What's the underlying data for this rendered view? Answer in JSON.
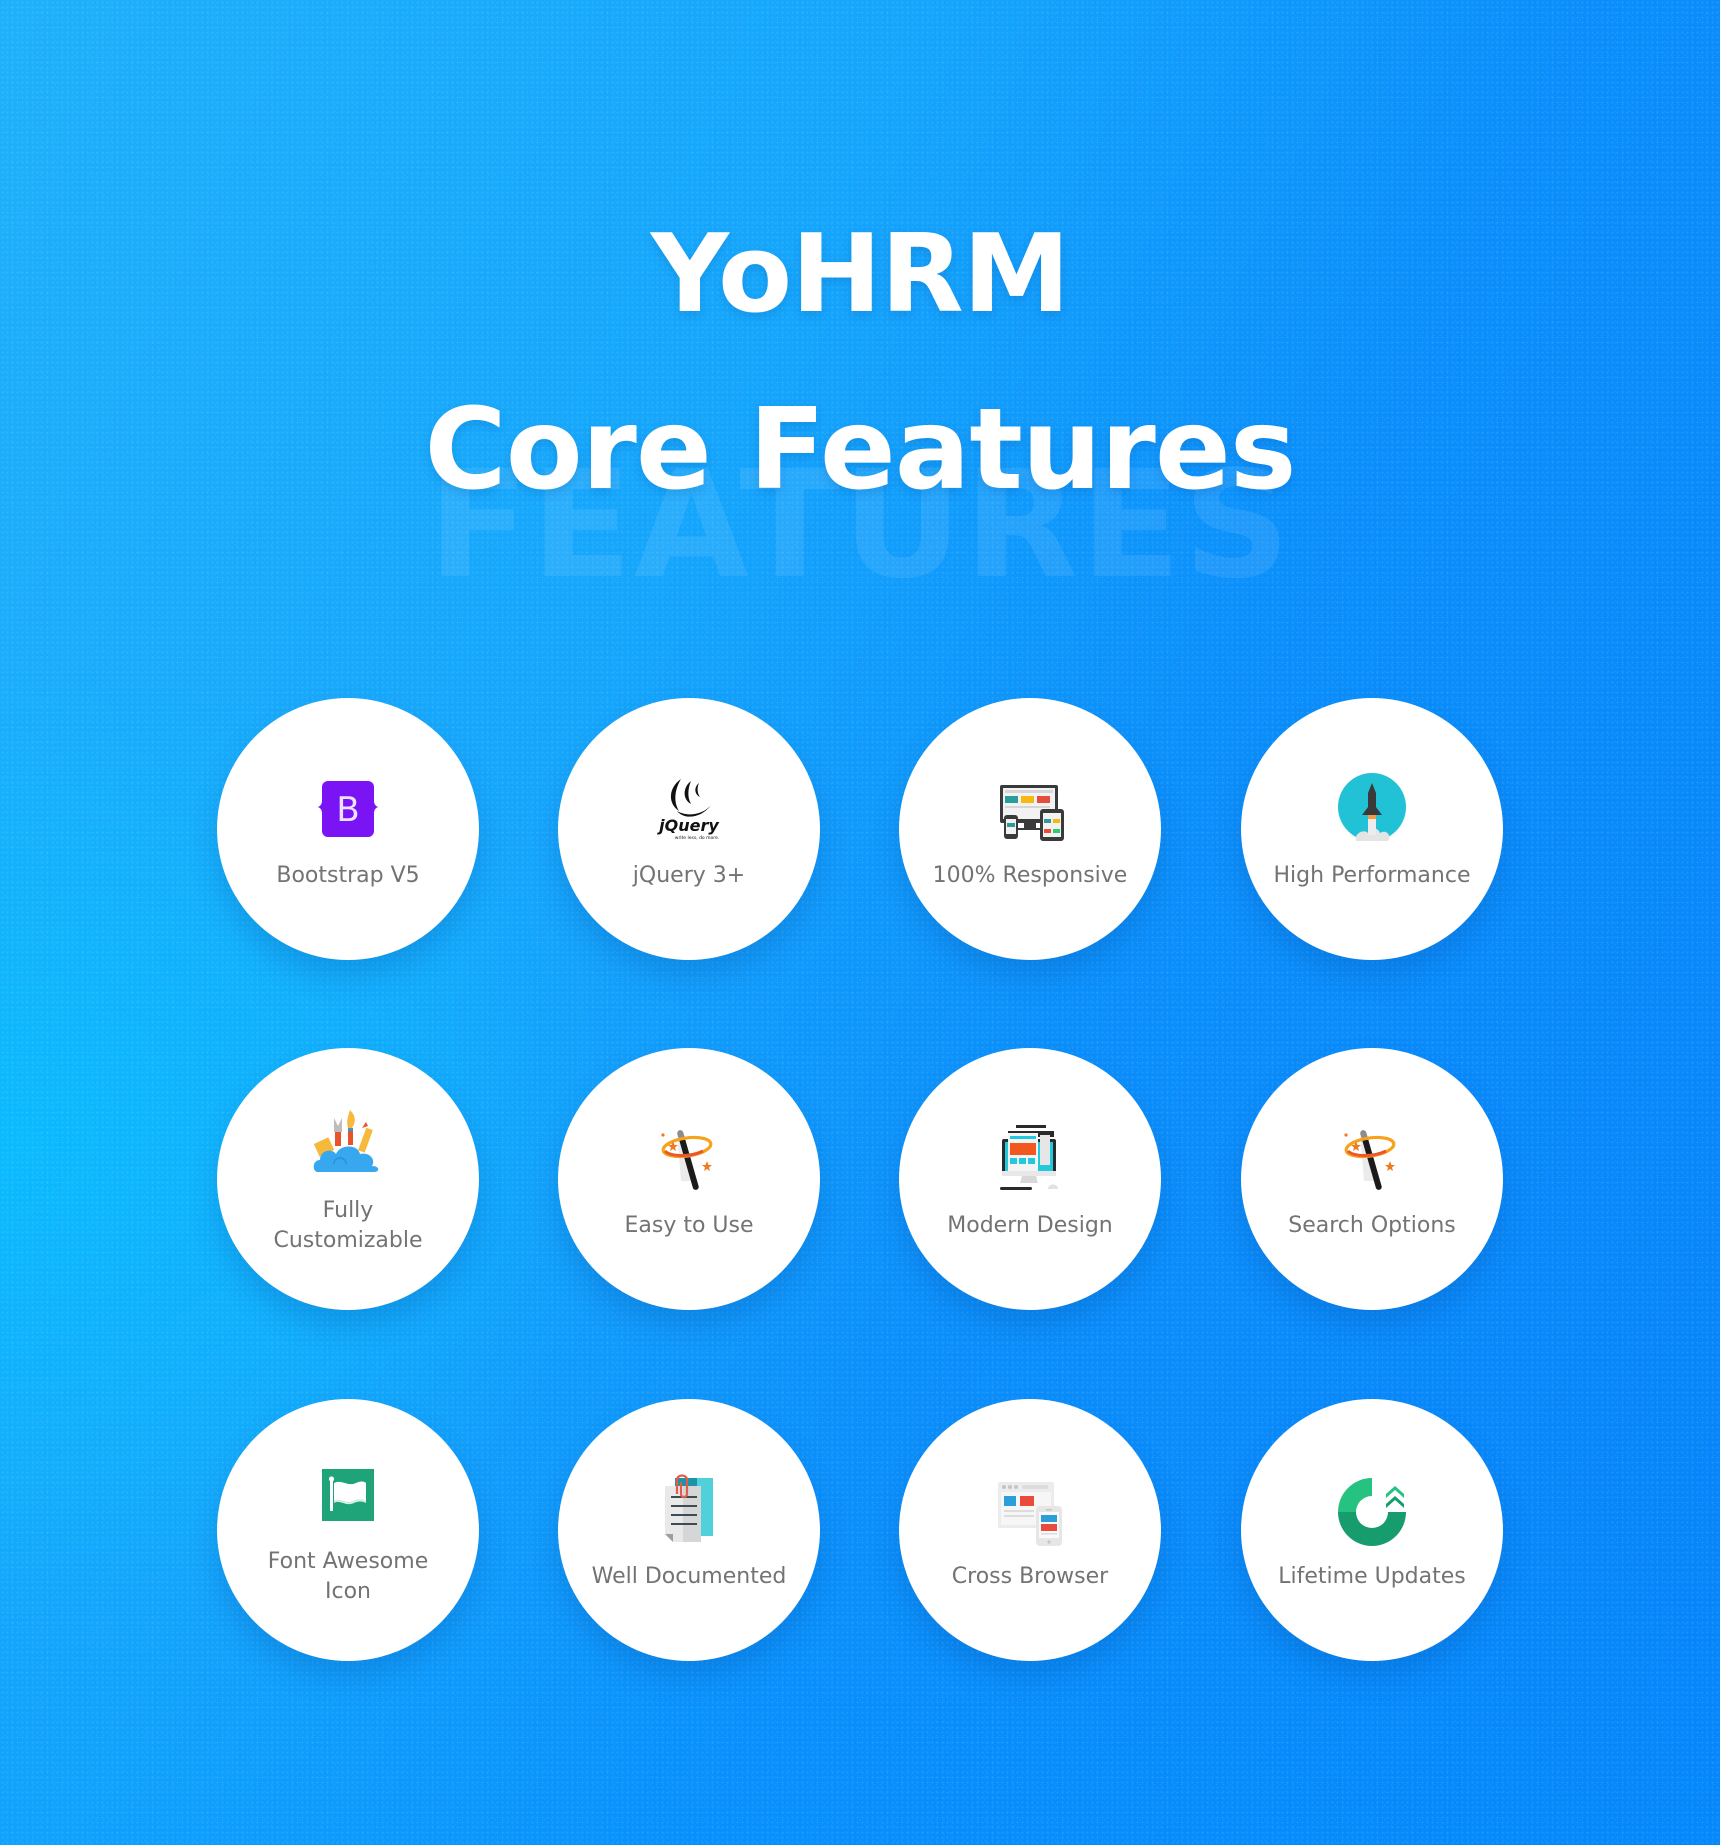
{
  "header": {
    "brand": "YoHRM",
    "title": "Core Features",
    "watermark": "FEATURES"
  },
  "colors": {
    "background_start": "#1fb0fb",
    "background_end": "#0683fa",
    "card_background": "#ffffff",
    "label_text": "#737373",
    "bootstrap_purple": "#7b14f5",
    "rocket_teal": "#22c2d6",
    "flag_green": "#1fa47a",
    "update_green": "#26b67e"
  },
  "features": [
    {
      "label": "Bootstrap V5",
      "icon": "bootstrap-logo-icon"
    },
    {
      "label": "jQuery 3+",
      "icon": "jquery-logo-icon",
      "icon_tagline": "write less, do more."
    },
    {
      "label": "100% Responsive",
      "icon": "responsive-devices-icon"
    },
    {
      "label": "High Performance",
      "icon": "rocket-launch-icon"
    },
    {
      "label": "Fully Customizable",
      "icon": "design-tools-cloud-icon"
    },
    {
      "label": "Easy to Use",
      "icon": "magic-wand-icon"
    },
    {
      "label": "Modern Design",
      "icon": "desktop-layout-icon"
    },
    {
      "label": "Search Options",
      "icon": "magic-wand-icon"
    },
    {
      "label": "Font Awesome Icon",
      "icon": "flag-icon"
    },
    {
      "label": "Well Documented",
      "icon": "document-clip-icon"
    },
    {
      "label": "Cross Browser",
      "icon": "browser-mobile-icon"
    },
    {
      "label": "Lifetime Updates",
      "icon": "update-arrows-icon"
    }
  ]
}
